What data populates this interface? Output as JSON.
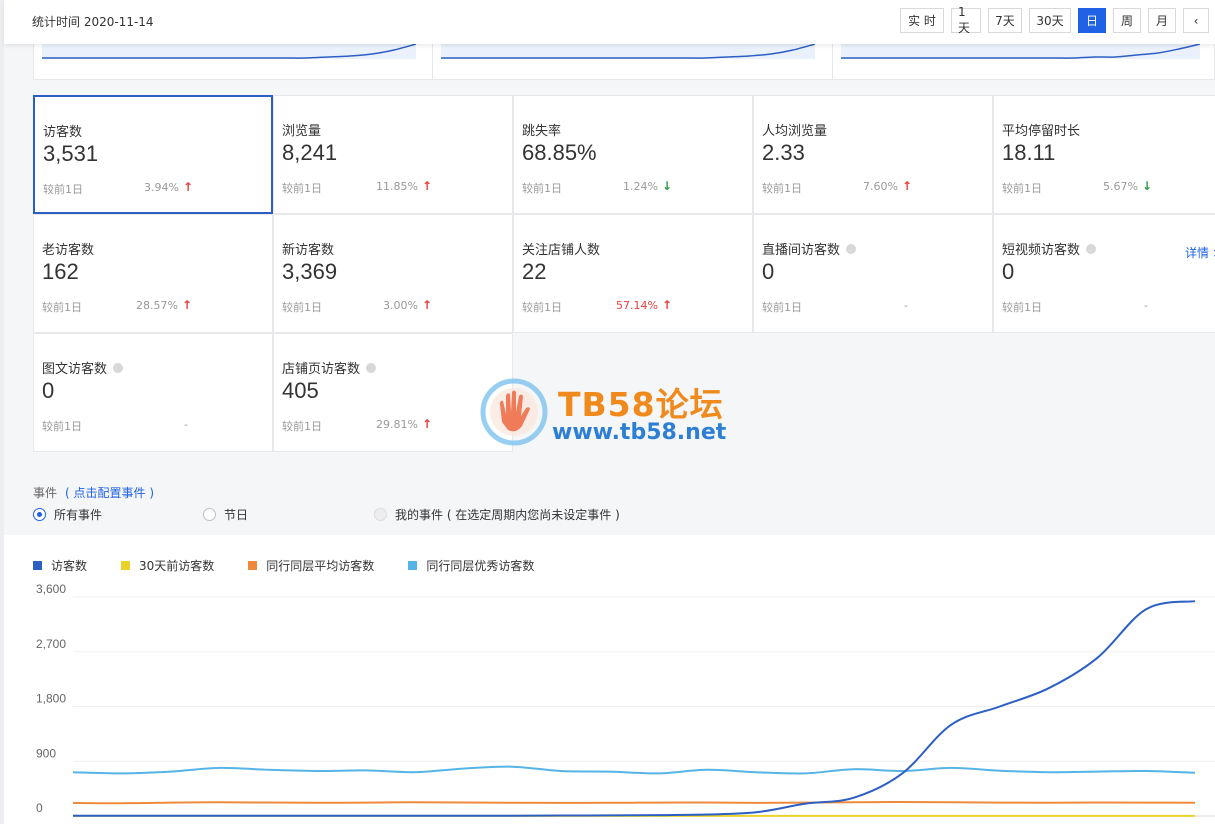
{
  "header": {
    "date_label": "统计时间 2020-11-14"
  },
  "periods": [
    {
      "label": "实 时",
      "active": false
    },
    {
      "label": "1天",
      "active": false
    },
    {
      "label": "7天",
      "active": false
    },
    {
      "label": "30天",
      "active": false
    },
    {
      "label": "日",
      "active": true
    },
    {
      "label": "周",
      "active": false
    },
    {
      "label": "月",
      "active": false
    },
    {
      "label": "‹",
      "active": false
    }
  ],
  "metrics": [
    {
      "label": "访客数",
      "value": "3,531",
      "cmp_label": "较前1日",
      "change": "3.94%",
      "trend": "up",
      "info": false,
      "selected": true
    },
    {
      "label": "浏览量",
      "value": "8,241",
      "cmp_label": "较前1日",
      "change": "11.85%",
      "trend": "up",
      "info": false
    },
    {
      "label": "跳失率",
      "value": "68.85%",
      "cmp_label": "较前1日",
      "change": "1.24%",
      "trend": "down",
      "info": false
    },
    {
      "label": "人均浏览量",
      "value": "2.33",
      "cmp_label": "较前1日",
      "change": "7.60%",
      "trend": "up",
      "info": false
    },
    {
      "label": "平均停留时长",
      "value": "18.11",
      "cmp_label": "较前1日",
      "change": "5.67%",
      "trend": "down",
      "info": false
    },
    {
      "label": "老访客数",
      "value": "162",
      "cmp_label": "较前1日",
      "change": "28.57%",
      "trend": "up",
      "info": false
    },
    {
      "label": "新访客数",
      "value": "3,369",
      "cmp_label": "较前1日",
      "change": "3.00%",
      "trend": "up",
      "info": false
    },
    {
      "label": "关注店铺人数",
      "value": "22",
      "cmp_label": "较前1日",
      "change": "57.14%",
      "trend": "up",
      "info": false,
      "highlight": true
    },
    {
      "label": "直播间访客数",
      "value": "0",
      "cmp_label": "较前1日",
      "change": "-",
      "trend": "none",
      "info": true
    },
    {
      "label": "短视频访客数",
      "value": "0",
      "cmp_label": "较前1日",
      "change": "-",
      "trend": "none",
      "info": true
    },
    {
      "label": "图文访客数",
      "value": "0",
      "cmp_label": "较前1日",
      "change": "-",
      "trend": "none",
      "info": true
    },
    {
      "label": "店铺页访客数",
      "value": "405",
      "cmp_label": "较前1日",
      "change": "29.81%",
      "trend": "up",
      "info": true
    }
  ],
  "detail_link": "详情 >",
  "watermark": {
    "title": "TB58论坛",
    "url": "www.tb58.net"
  },
  "events": {
    "label": "事件",
    "config_link": "( 点击配置事件 )",
    "options": [
      {
        "label": "所有事件",
        "state": "on"
      },
      {
        "label": "节日",
        "state": "off"
      },
      {
        "label": "我的事件 ( 在选定周期内您尚未设定事件 )",
        "state": "disabled"
      }
    ]
  },
  "colors": {
    "accent": "#2062e6",
    "up": "#e8403b",
    "down": "#2a9d3d"
  },
  "chart_data": {
    "type": "line",
    "ylim": [
      0,
      3600
    ],
    "yticks": [
      "3,600",
      "2,700",
      "1,800",
      "900",
      "0"
    ],
    "grid": true,
    "legend_position": "top-left",
    "x_count": 24,
    "series": [
      {
        "name": "访客数",
        "color": "#2c5fc4",
        "values": [
          5,
          5,
          5,
          5,
          5,
          5,
          5,
          5,
          5,
          5,
          8,
          10,
          15,
          25,
          60,
          200,
          300,
          700,
          1500,
          1800,
          2100,
          2600,
          3400,
          3531
        ]
      },
      {
        "name": "30天前访客数",
        "color": "#ead22a",
        "values": [
          2,
          2,
          2,
          2,
          2,
          2,
          2,
          2,
          2,
          2,
          2,
          2,
          2,
          2,
          2,
          2,
          2,
          2,
          2,
          2,
          2,
          2,
          2,
          2
        ]
      },
      {
        "name": "同行同层平均访客数",
        "color": "#ef8a3d",
        "values": [
          215,
          210,
          220,
          225,
          222,
          218,
          220,
          225,
          222,
          218,
          215,
          218,
          220,
          222,
          215,
          220,
          225,
          230,
          225,
          220,
          218,
          222,
          220,
          218
        ]
      },
      {
        "name": "同行同层优秀访客数",
        "color": "#56b4e6",
        "values": [
          720,
          700,
          730,
          790,
          760,
          740,
          750,
          720,
          780,
          810,
          740,
          730,
          700,
          760,
          720,
          700,
          770,
          740,
          790,
          745,
          720,
          730,
          740,
          710
        ]
      }
    ]
  },
  "mini_charts": [
    {
      "values": [
        0,
        0,
        0,
        0,
        0,
        0,
        0,
        0,
        0,
        0,
        0,
        0,
        0,
        1,
        2,
        4,
        8,
        14
      ]
    },
    {
      "values": [
        0,
        0,
        0,
        0,
        0,
        0,
        0,
        0,
        0,
        0,
        0,
        0,
        0,
        1,
        2,
        4,
        8,
        14
      ]
    },
    {
      "values": [
        0,
        0,
        0,
        0,
        0,
        0,
        0,
        0,
        0,
        0,
        0,
        0,
        1,
        1,
        3,
        5,
        9,
        14
      ]
    }
  ]
}
